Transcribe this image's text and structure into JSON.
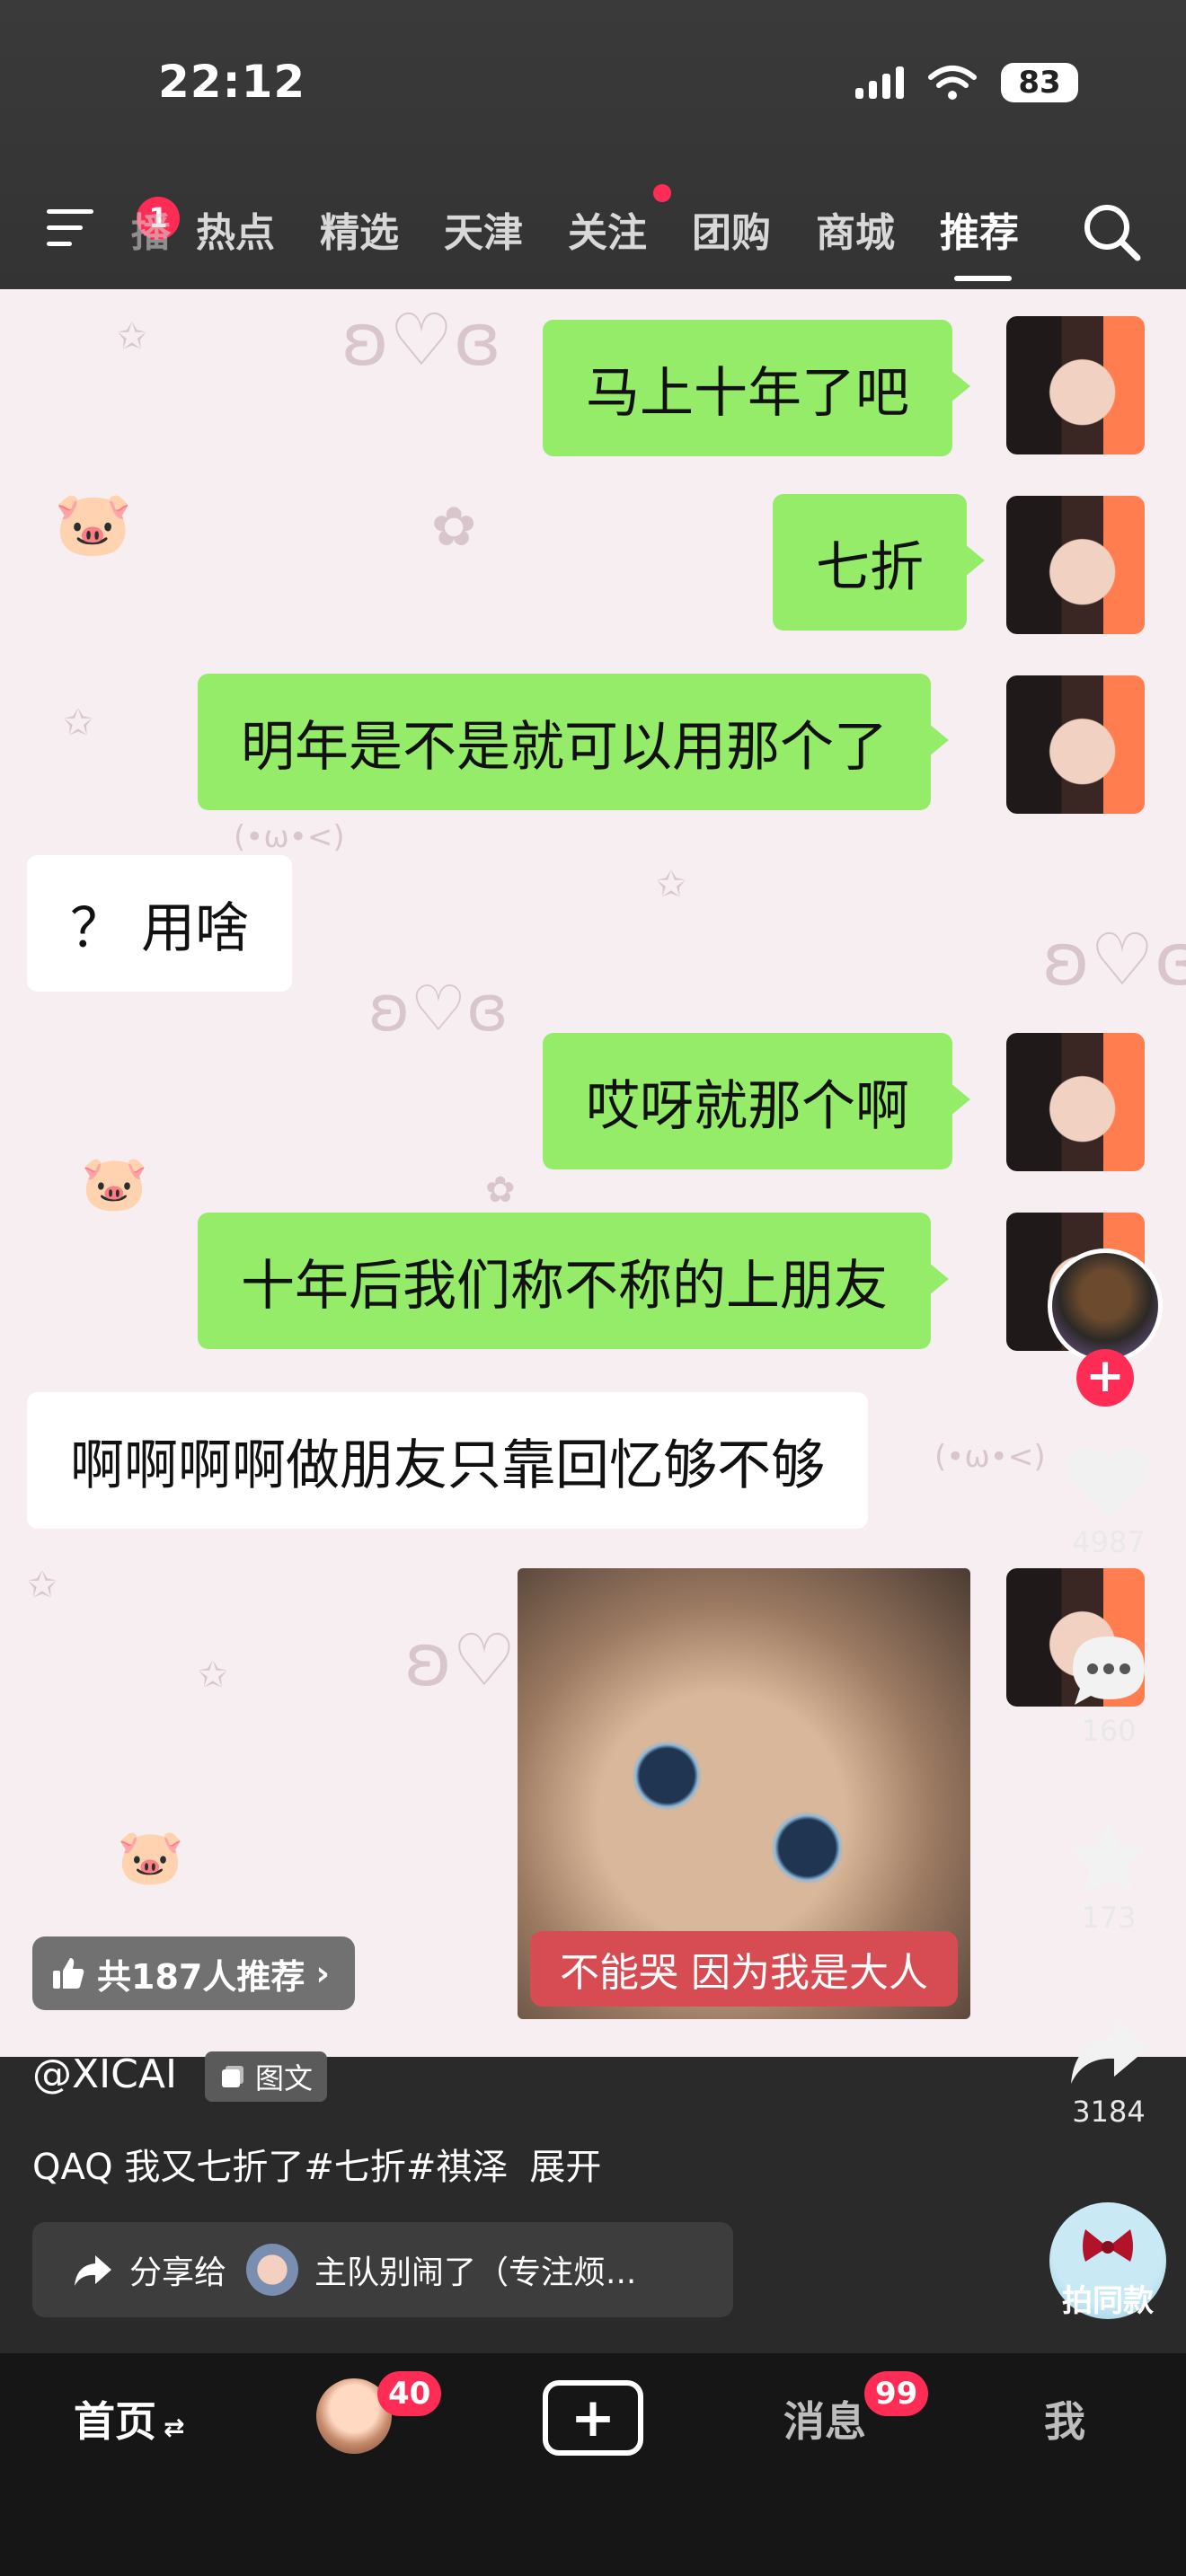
{
  "status_bar": {
    "time": "22:12",
    "battery": "83"
  },
  "top_nav": {
    "menu_badge": "1",
    "tabs": [
      {
        "label": "播"
      },
      {
        "label": "热点"
      },
      {
        "label": "精选"
      },
      {
        "label": "天津"
      },
      {
        "label": "关注"
      },
      {
        "label": "团购"
      },
      {
        "label": "商城"
      },
      {
        "label": "推荐"
      }
    ],
    "active_tab": "推荐"
  },
  "chat": {
    "messages": [
      {
        "from": "me",
        "text": "马上十年了吧"
      },
      {
        "from": "me",
        "text": "七折"
      },
      {
        "from": "me",
        "text": "明年是不是就可以用那个了"
      },
      {
        "from": "other",
        "text": "？ 用啥"
      },
      {
        "from": "me",
        "text": "哎呀就那个啊"
      },
      {
        "from": "me",
        "text": "十年后我们称不称的上朋友"
      },
      {
        "from": "other",
        "text": "啊啊啊啊做朋友只靠回忆够不够"
      }
    ],
    "sticker_caption": "不能哭 因为我是大人",
    "doodle_text": "(•ω•<)"
  },
  "recommend": {
    "label": "共187人推荐",
    "chevron": "›"
  },
  "actions": {
    "follow_plus": "+",
    "like_count": "4987",
    "comment_count": "160",
    "favorite_count": "173",
    "share_count": "3184"
  },
  "post": {
    "author": "@XICAI",
    "type_tag": "图文",
    "caption": "QAQ 我又七折了#七折#祺泽",
    "expand": "展开",
    "share_label": "分享给",
    "share_target": "主队别闹了（专注烦...",
    "same_style_label": "拍同款"
  },
  "bottom_tabs": {
    "home": "首页",
    "home_suffix": "⇄",
    "friends_badge": "40",
    "add_symbol": "+",
    "messages": "消息",
    "messages_badge": "99",
    "me": "我"
  },
  "colors": {
    "my_bubble": "#95ec69",
    "other_bubble": "#ffffff",
    "badge": "#ff2d55",
    "caption_bg": "#d64c52"
  }
}
